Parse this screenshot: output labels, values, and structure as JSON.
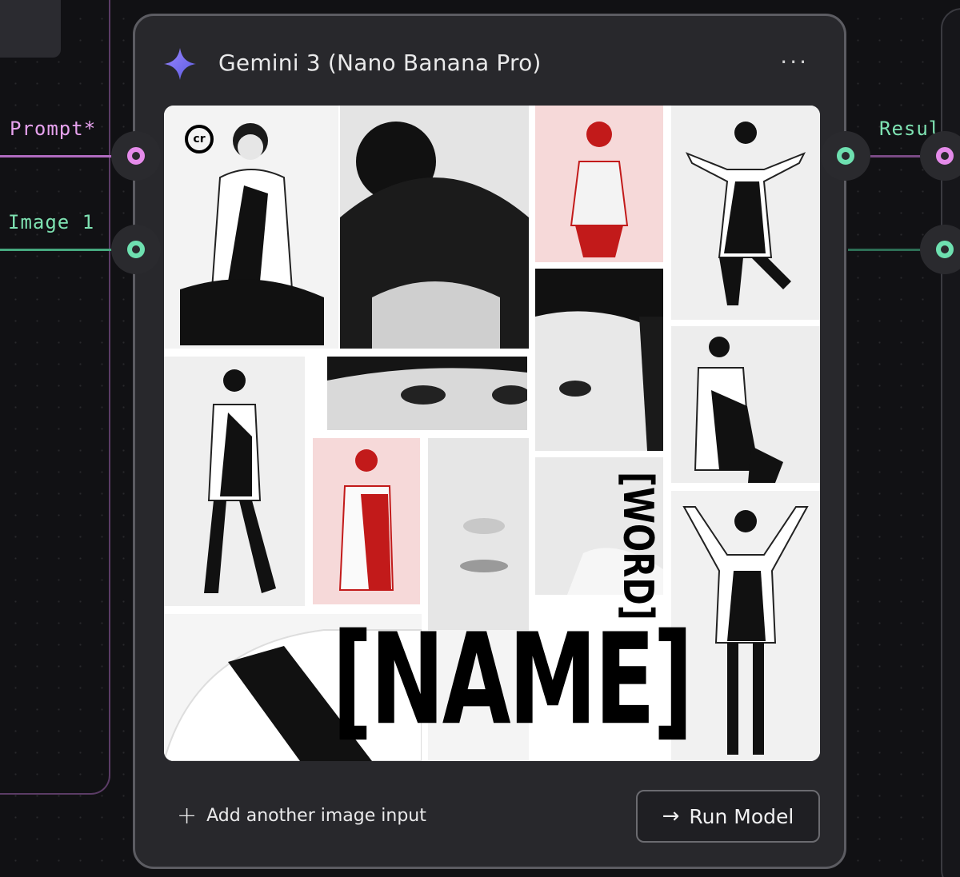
{
  "ports": {
    "prompt_label": "Prompt*",
    "image_label": "Image 1",
    "result_label": "Result"
  },
  "node": {
    "title": "Gemini 3 (Nano Banana Pro)",
    "more_glyph": "···",
    "icon": "sparkle-icon",
    "accent_color": "#7b6cf0"
  },
  "preview": {
    "logo_text": "cr",
    "headline": "[NAME]",
    "side_word": "[WORD]"
  },
  "footer": {
    "add_input_glyph": "+",
    "add_input_label": "Add another image input",
    "run_glyph": "→",
    "run_label": "Run Model"
  },
  "colors": {
    "prompt_port": "#e58bea",
    "image_port": "#6ee0b0",
    "node_bg": "#28282c"
  }
}
